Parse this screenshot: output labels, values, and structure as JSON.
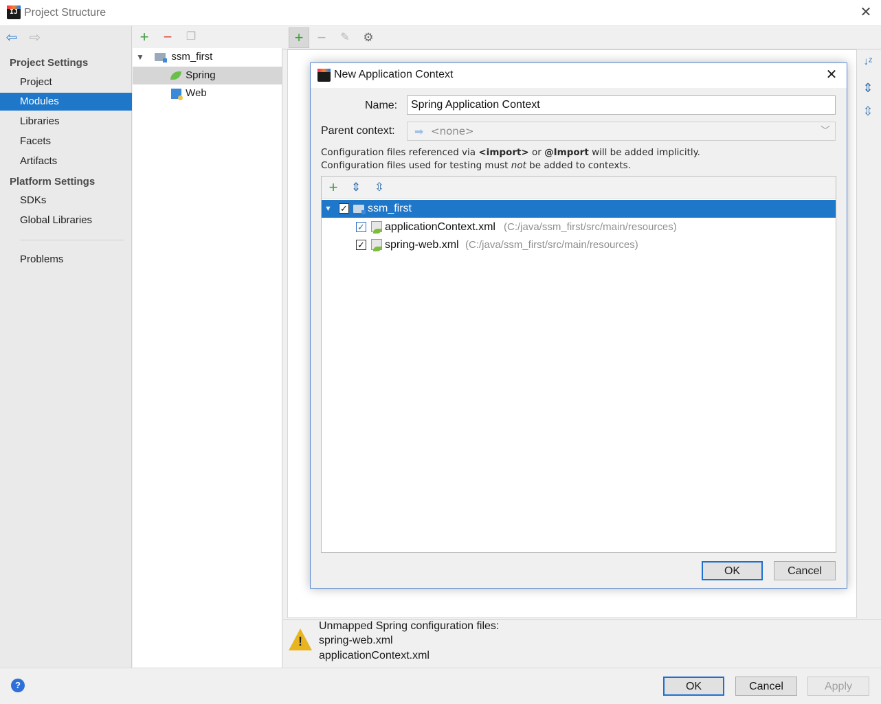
{
  "window": {
    "title": "Project Structure"
  },
  "nav": {
    "project_settings": "Project Settings",
    "project_items": [
      "Project",
      "Modules",
      "Libraries",
      "Facets",
      "Artifacts"
    ],
    "selected": "Modules",
    "platform_settings": "Platform Settings",
    "platform_items": [
      "SDKs",
      "Global Libraries"
    ],
    "problems": "Problems"
  },
  "tree": {
    "root": "ssm_first",
    "children": [
      "Spring",
      "Web"
    ],
    "selected": "Spring"
  },
  "warning": {
    "title": "Unmapped Spring configuration files:",
    "files": [
      "spring-web.xml",
      "applicationContext.xml"
    ]
  },
  "footer": {
    "ok": "OK",
    "cancel": "Cancel",
    "apply": "Apply",
    "help": "?"
  },
  "dialog": {
    "title": "New Application Context",
    "name_label": "Name:",
    "name_value": "Spring Application Context",
    "parent_label": "Parent context:",
    "parent_value": "<none>",
    "info": {
      "l1_a": "Configuration files referenced via",
      "l1_import_tag": "<import>",
      "l1_or": "or",
      "l1_import_ann": "@Import",
      "l1_b": "will be added implicitly.",
      "l2_a": "Configuration files used for testing must",
      "l2_not": "not",
      "l2_b": "be added to contexts."
    },
    "root": "ssm_first",
    "files": [
      {
        "name": "applicationContext.xml",
        "path": "(C:/java/ssm_first/src/main/resources)"
      },
      {
        "name": "spring-web.xml",
        "path": "(C:/java/ssm_first/src/main/resources)"
      }
    ],
    "ok": "OK",
    "cancel": "Cancel"
  },
  "colors": {
    "selection": "#1f77c9",
    "accent_border": "#1f6fd0",
    "warning": "#e8b520"
  }
}
